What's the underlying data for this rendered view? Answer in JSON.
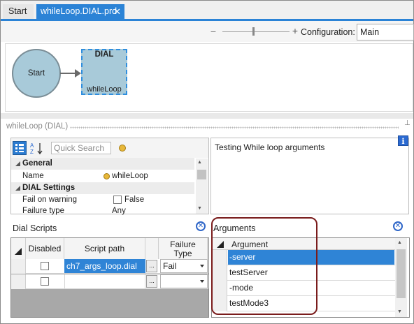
{
  "tabs": [
    {
      "label": "Start",
      "active": false
    },
    {
      "label": "whileLoop.DIAL.prd",
      "active": true
    }
  ],
  "toolbar": {
    "zoom_minus": "−",
    "zoom_plus": "+",
    "config_label": "Configuration:",
    "config_value": "Main"
  },
  "canvas": {
    "start_label": "Start",
    "dial_title": "DIAL",
    "dial_name": "whileLoop"
  },
  "panel": {
    "title": "whileLoop (DIAL)"
  },
  "properties": {
    "search_placeholder": "Quick Search",
    "categories": [
      {
        "name": "General",
        "rows": [
          {
            "name": "Name",
            "value": "whileLoop"
          }
        ]
      },
      {
        "name": "DIAL Settings",
        "rows": [
          {
            "name": "Fail on warning",
            "value": "False"
          },
          {
            "name": "Failure type",
            "value": "Any"
          }
        ]
      }
    ]
  },
  "description": {
    "text": "Testing While loop arguments"
  },
  "dial_scripts": {
    "title": "Dial Scripts",
    "headers": [
      "Disabled",
      "Script path",
      "Failure Type"
    ],
    "rows": [
      {
        "disabled": false,
        "path": "ch7_args_loop.dial",
        "failure_type": "Fail"
      },
      {
        "disabled": false,
        "path": "",
        "failure_type": ""
      }
    ]
  },
  "arguments": {
    "title": "Arguments",
    "header": "Argument",
    "items": [
      "-server",
      "testServer",
      "-mode",
      "testMode3"
    ],
    "selected_index": 0
  },
  "colors": {
    "accent": "#2b83d6",
    "selection": "#2f84d6",
    "node_fill": "#a8cad9",
    "highlight_border": "#7a1c1c"
  }
}
